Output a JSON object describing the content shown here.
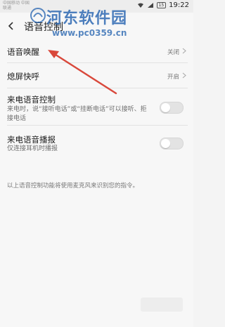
{
  "status_bar": {
    "carrier": "中国移动 中国联通",
    "battery": "15",
    "time": "19:22"
  },
  "header": {
    "title": "语音控制"
  },
  "watermark": {
    "logo_text": "河东软件园",
    "url": "www.pc0359.cn"
  },
  "rows": [
    {
      "title": "语音唤醒",
      "value": "关闭"
    },
    {
      "title": "熄屏快呼",
      "value": "开启"
    },
    {
      "title": "来电语音控制",
      "desc": "来电时，说“接听电话”或“挂断电话”可以接听、拒接电话",
      "toggle_on": false
    },
    {
      "title": "来电语音播报",
      "desc": "仅连接耳机时播报",
      "toggle_on": false
    }
  ],
  "footnote": "以上语音控制功能将使用麦克风来识别您的指令。",
  "colors": {
    "accent_arrow": "#d9483b",
    "watermark": "#2f6ab3"
  }
}
